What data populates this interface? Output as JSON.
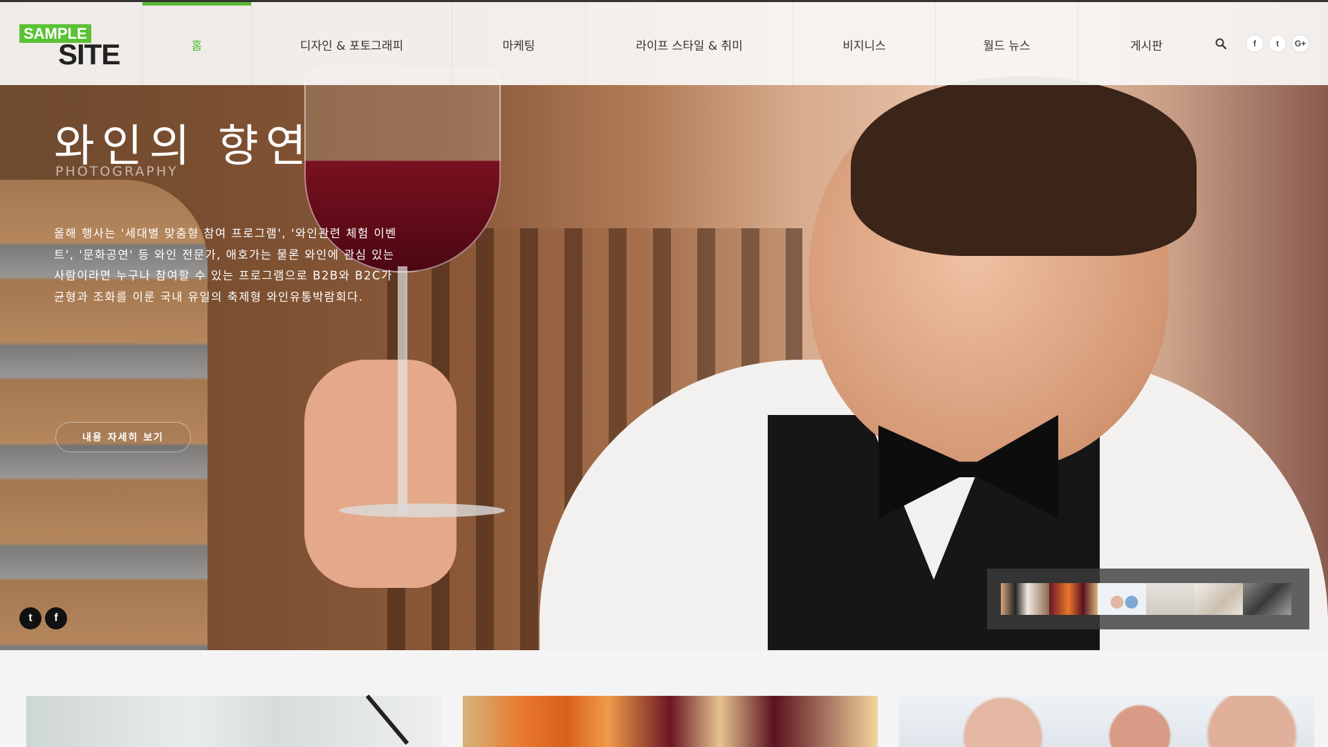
{
  "logo": {
    "sample": "SAMPLE",
    "site": "SITE"
  },
  "nav": {
    "items": [
      {
        "label": "홈",
        "active": true
      },
      {
        "label": "디자인 & 포토그래피"
      },
      {
        "label": "마케팅"
      },
      {
        "label": "라이프 스타일 & 취미"
      },
      {
        "label": "비지니스"
      },
      {
        "label": "월드 뉴스"
      },
      {
        "label": "게시판"
      }
    ],
    "icons": [
      "search-icon",
      "facebook-icon",
      "twitter-icon",
      "google-plus-icon"
    ],
    "social_glyphs": {
      "facebook": "f",
      "twitter": "t",
      "google": "G+"
    }
  },
  "hero": {
    "title": "와인의 향연",
    "subtitle": "PHOTOGRAPHY",
    "description": "올해 행사는 '세대별 맞춤형 참여 프로그램', '와인관련 체험 이벤트', '문화공연' 등 와인 전문가, 애호가는 물론 와인에 관심 있는 사람이라면 누구나 참여할 수 있는 프로그램으로 B2B와 B2C가 균형과 조화를 이룬 국내 유일의 축제형 와인유통박람회다.",
    "button_label": "내용 자세히 보기",
    "share_glyphs": {
      "twitter": "t",
      "facebook": "f"
    }
  },
  "accent_color": "#57b932"
}
